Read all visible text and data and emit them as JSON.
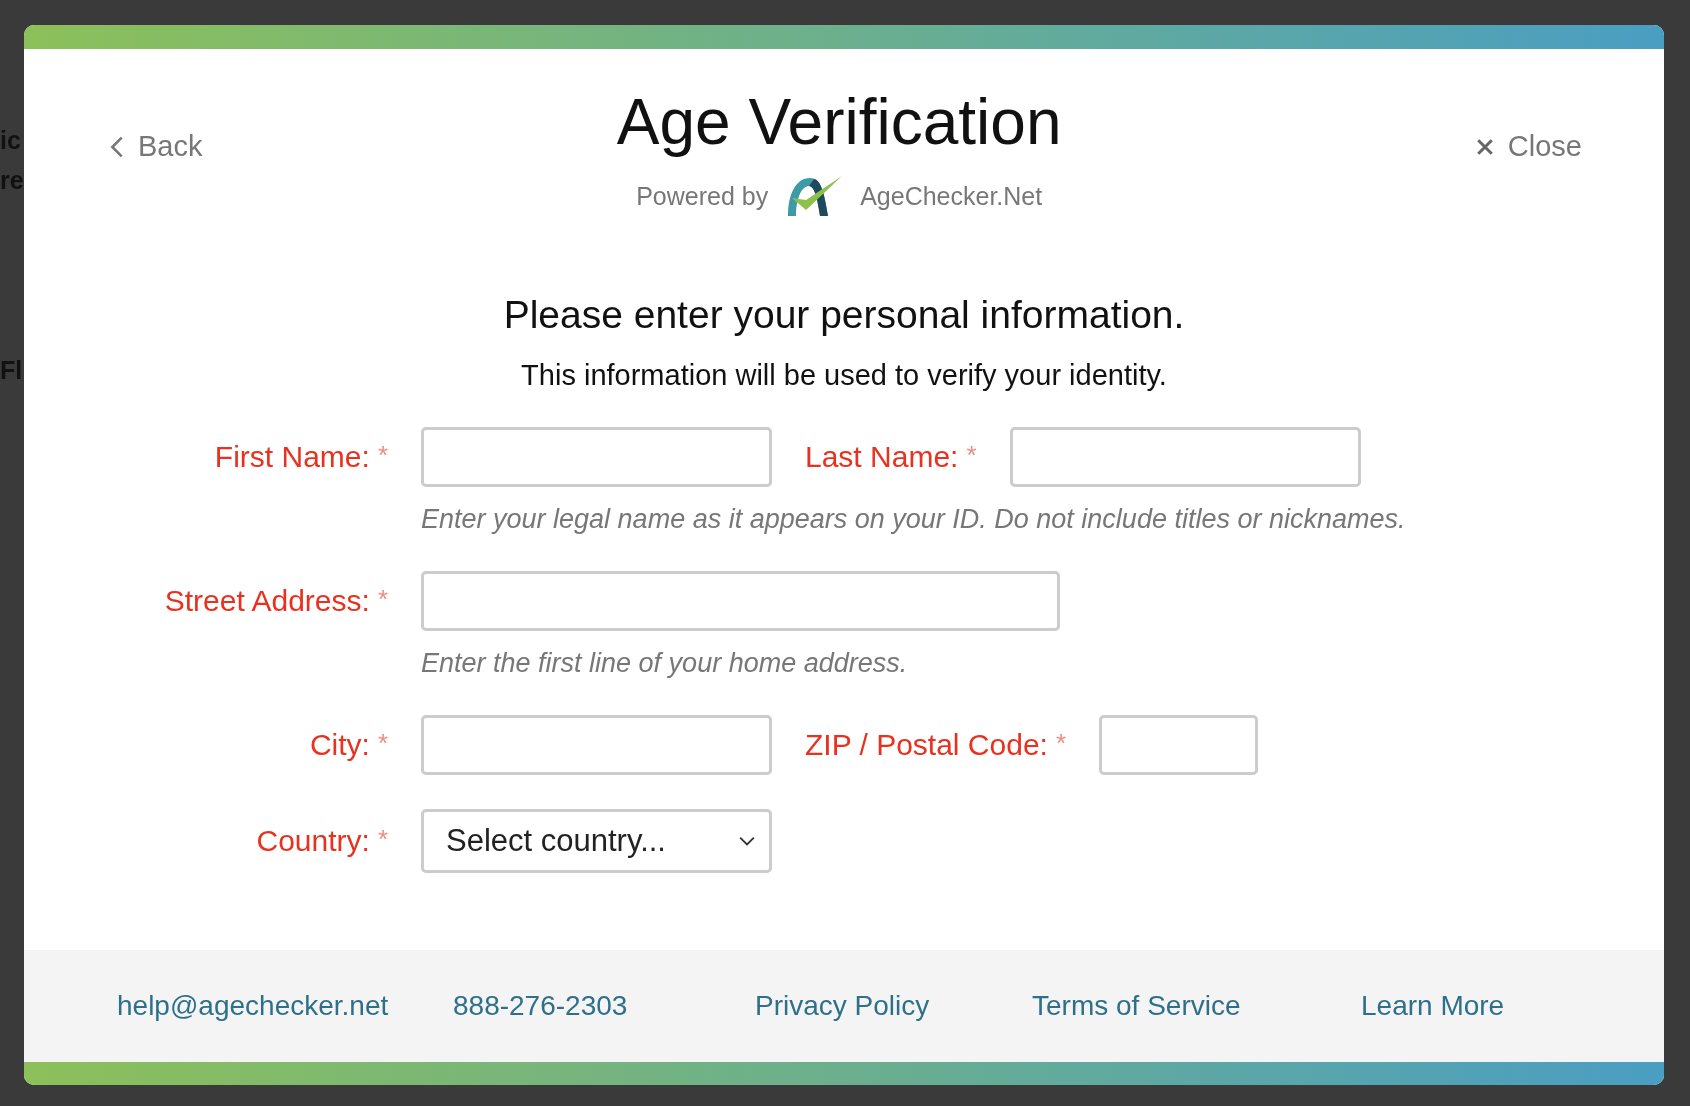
{
  "background": {
    "fragments": [
      "ic",
      "re",
      "Fl"
    ]
  },
  "header": {
    "back": "Back",
    "title": "Age Verification",
    "powered_by": "Powered by",
    "brand": "AgeChecker.Net",
    "close": "Close"
  },
  "form": {
    "heading": "Please enter your personal information.",
    "subheading": "This information will be used to verify your identity.",
    "rows": [
      {
        "fields": [
          {
            "label": "First Name:",
            "marker": "*",
            "kind": "text"
          },
          {
            "label": "Last Name:",
            "marker": "*",
            "kind": "text"
          }
        ],
        "hint": "Enter your legal name as it appears on your ID. Do not include titles or nicknames."
      },
      {
        "fields": [
          {
            "label": "Street Address:",
            "marker": "*",
            "kind": "wide-text"
          }
        ],
        "hint": "Enter the first line of your home address."
      },
      {
        "fields": [
          {
            "label": "City:",
            "marker": "*",
            "kind": "text"
          },
          {
            "label": "ZIP / Postal Code:",
            "marker": "*",
            "kind": "short-text"
          }
        ]
      },
      {
        "fields": [
          {
            "label": "Country:",
            "marker": "*",
            "kind": "select",
            "value": "Select country..."
          }
        ]
      }
    ]
  },
  "footer": {
    "links": [
      "help@agechecker.net",
      "888-276-2303",
      "Privacy Policy",
      "Terms of Service",
      "Learn More"
    ]
  }
}
